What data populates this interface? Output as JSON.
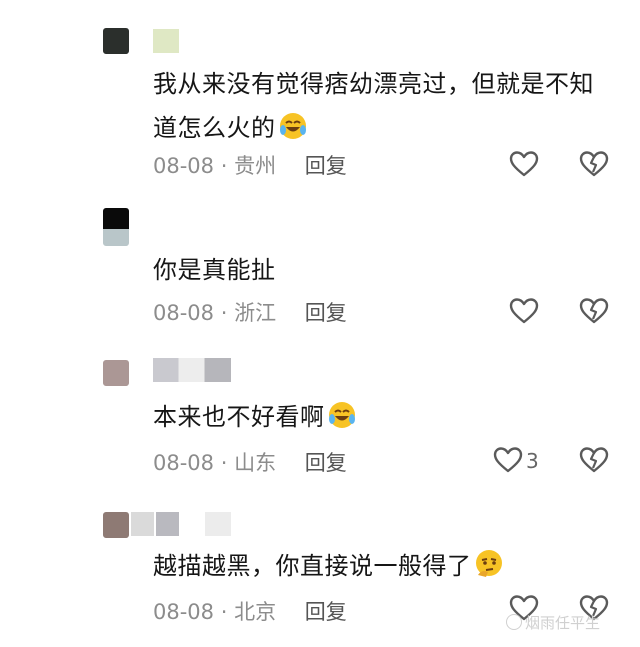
{
  "comments": [
    {
      "text": "我从来没有觉得痞幼漂亮过，但就是不知道怎么火的",
      "emoji": "laughing-crying-emoji",
      "date": "08-08",
      "location": "贵州",
      "reply": "回复",
      "likes": ""
    },
    {
      "text": "你是真能扯",
      "emoji": "",
      "date": "08-08",
      "location": "浙江",
      "reply": "回复",
      "likes": ""
    },
    {
      "text": "本来也不好看啊",
      "emoji": "laughing-crying-emoji",
      "date": "08-08",
      "location": "山东",
      "reply": "回复",
      "likes": "3"
    },
    {
      "text": "越描越黑，你直接说一般得了",
      "emoji": "thinking-emoji",
      "date": "08-08",
      "location": "北京",
      "reply": "回复",
      "likes": ""
    }
  ],
  "separator": "·",
  "watermark": "烟雨任平生",
  "colors": {
    "text": "#161616",
    "meta": "#8c8c8c",
    "icon": "#5a5a5a"
  }
}
